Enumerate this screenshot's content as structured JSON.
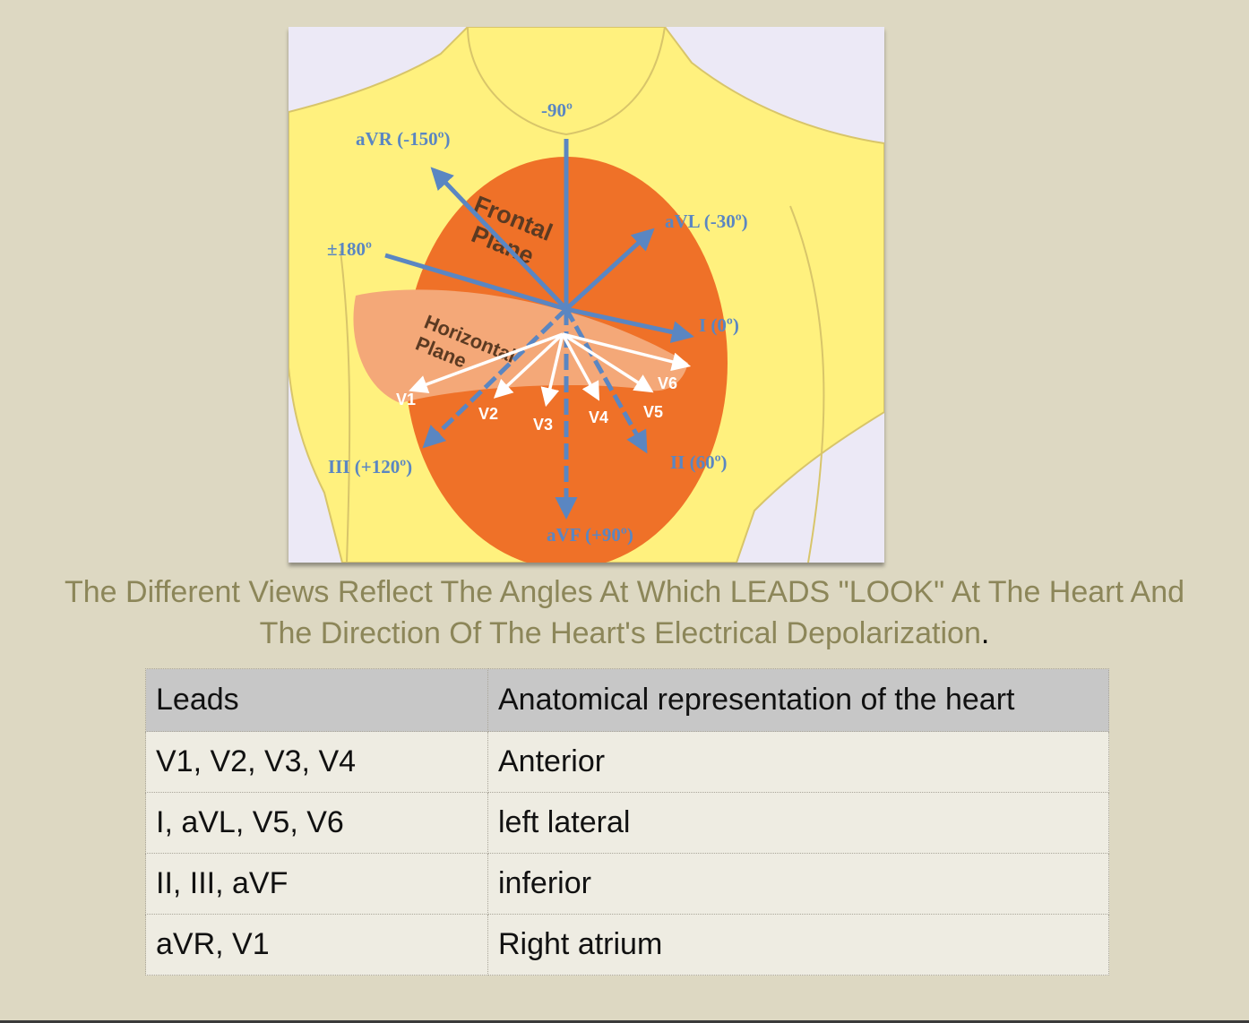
{
  "figure": {
    "frontal_plane_label": [
      "Frontal",
      "Plane"
    ],
    "horizontal_plane_label": [
      "Horizontal",
      "Plane"
    ],
    "limb_leads": [
      {
        "label": "-90º",
        "angle": -90
      },
      {
        "label": "aVR (-150º)",
        "angle": -150
      },
      {
        "label": "aVL (-30º)",
        "angle": -30
      },
      {
        "label": "±180º",
        "angle": 180
      },
      {
        "label": "I (0º)",
        "angle": 0
      },
      {
        "label": "III (+120º)",
        "angle": 120
      },
      {
        "label": "II (60º)",
        "angle": 60
      },
      {
        "label": "aVF (+90º)",
        "angle": 90
      }
    ],
    "precordial_leads": [
      "V1",
      "V2",
      "V3",
      "V4",
      "V5",
      "V6"
    ],
    "colors": {
      "skin": "#fff17e",
      "heart_frontal": "#ef7128",
      "heart_horizontal": "#f4a878",
      "limb_lead_arrows": "#5a86c2",
      "precordial_arrows": "#ffffff"
    }
  },
  "caption": {
    "text": "The Different Views Reflect The Angles At Which LEADS \"LOOK\" At The Heart And The Direction Of The Heart's Electrical Depolarization",
    "end": "."
  },
  "table": {
    "headers": [
      "Leads",
      "Anatomical representation of the heart"
    ],
    "rows": [
      [
        "V1, V2, V3, V4",
        "Anterior"
      ],
      [
        "I, aVL, V5, V6",
        "left lateral"
      ],
      [
        "II, III, aVF",
        "inferior"
      ],
      [
        "aVR, V1",
        "Right atrium"
      ]
    ]
  }
}
